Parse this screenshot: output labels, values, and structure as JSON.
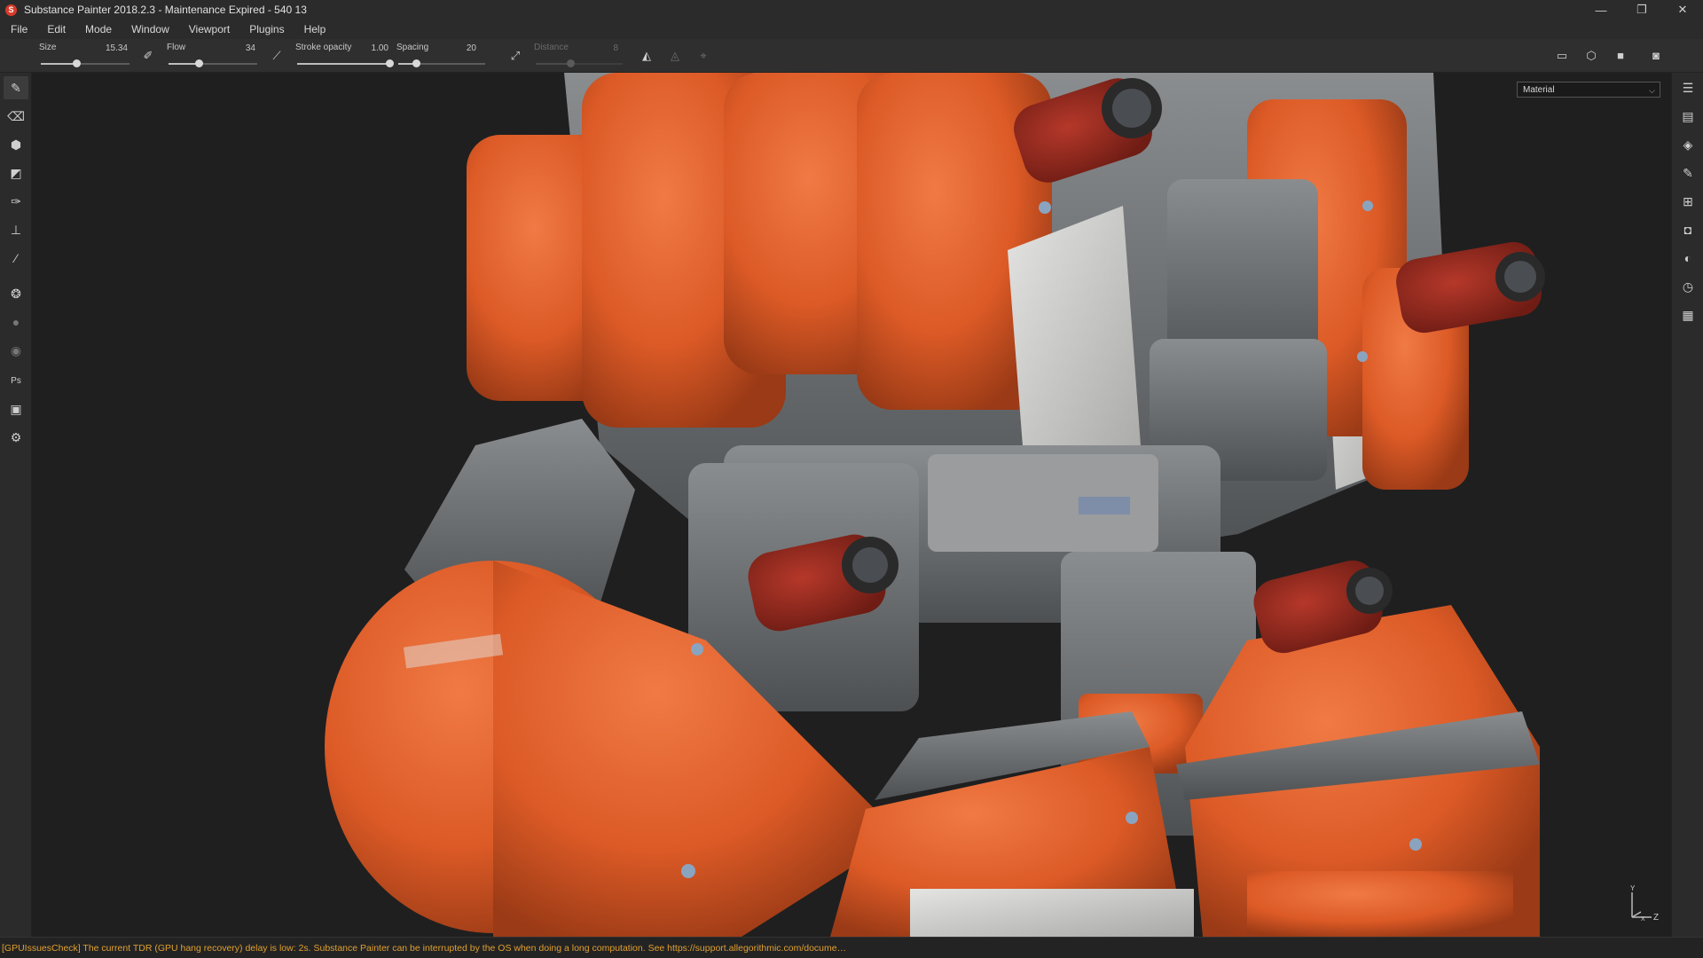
{
  "window": {
    "title": "Substance Painter 2018.2.3 - Maintenance Expired - 540 13",
    "app_icon": "substance-painter-logo",
    "controls": {
      "minimize": "—",
      "restore": "❐",
      "close": "✕"
    }
  },
  "menu": [
    "File",
    "Edit",
    "Mode",
    "Window",
    "Viewport",
    "Plugins",
    "Help"
  ],
  "toolbar": {
    "size": {
      "label": "Size",
      "value": "15.34",
      "fill": 0.4
    },
    "flow": {
      "label": "Flow",
      "value": "34",
      "fill": 0.34
    },
    "stroke_opacity": {
      "label": "Stroke opacity",
      "value": "1.00",
      "fill": 1.0
    },
    "spacing": {
      "label": "Spacing",
      "value": "20",
      "fill": 0.2
    },
    "distance": {
      "label": "Distance",
      "value": "8",
      "fill": 0.4,
      "enabled": false
    },
    "icons": [
      "brush-alpha-icon",
      "line-stroke-icon",
      "lazy-mouse-icon",
      "symmetry-icon",
      "symmetry-mirror-icon",
      "symmetry-options-icon",
      "view-2d-icon",
      "view-3d-icon",
      "camera-icon",
      "screenshot-icon"
    ]
  },
  "left_tools": [
    "paint-brush-icon",
    "eraser-icon",
    "projection-icon",
    "polygon-fill-icon",
    "smudge-icon",
    "clone-stamp-icon",
    "color-picker-icon",
    "bake-icon",
    "particle-icon",
    "geometry-mask-icon",
    "photoshop-export-icon",
    "export-icon",
    "settings-icon"
  ],
  "right_panels": [
    "layers-panel-icon",
    "texture-set-list-icon",
    "texture-set-settings-icon",
    "properties-icon",
    "shelf-icon",
    "display-settings-icon",
    "shader-settings-icon",
    "history-icon",
    "log-icon"
  ],
  "viewport": {
    "channel_select": "Material",
    "axis": {
      "y": "Y",
      "z": "Z",
      "x": "X"
    }
  },
  "status": {
    "message": "[GPUIssuesCheck] The current TDR (GPU hang recovery) delay is low: 2s. Substance Painter can be interrupted by the OS when doing a long computation. See https://support.allegorithmic.com/docume…"
  },
  "colors": {
    "accent_orange": "#e0612f",
    "warning_text": "#e0a030",
    "panel_bg": "#2b2b2b",
    "viewport_bg": "#1f1f1f"
  }
}
